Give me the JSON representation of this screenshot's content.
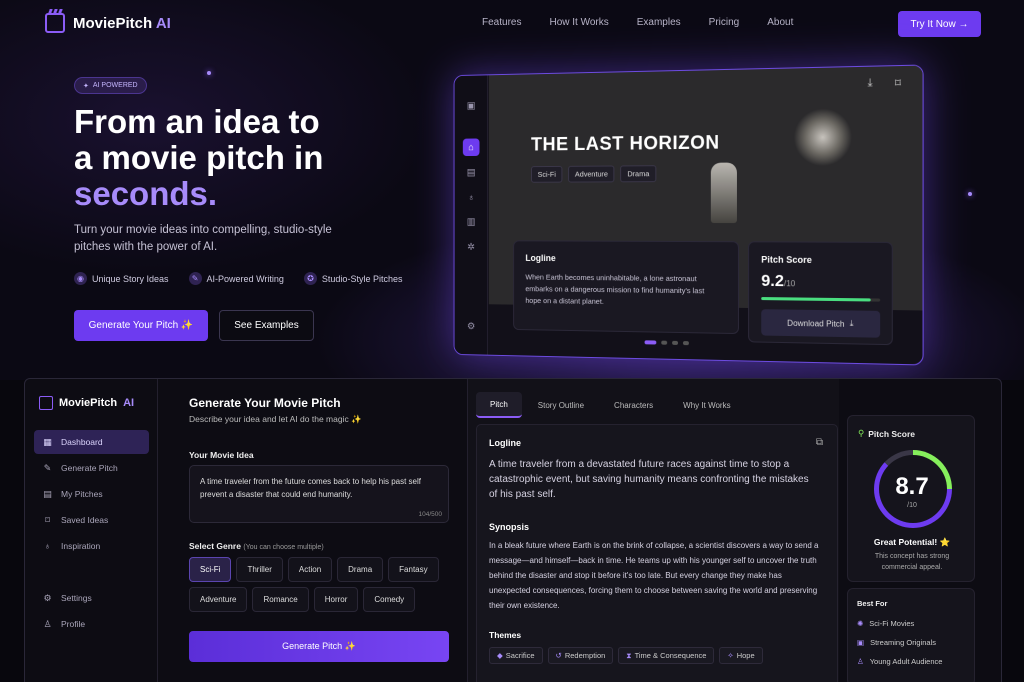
{
  "nav": {
    "brand": "MoviePitch",
    "brand_ai": "AI",
    "links": [
      "Features",
      "How It Works",
      "Examples",
      "Pricing",
      "About"
    ],
    "cta": "Try It Now →"
  },
  "hero": {
    "badge": "AI POWERED",
    "title_1": "From an idea to",
    "title_2": "a movie pitch in",
    "title_hl": "seconds.",
    "subtitle": "Turn your movie ideas into compelling, studio-style pitches with the power of AI.",
    "features": [
      "Unique Story Ideas",
      "AI-Powered Writing",
      "Studio-Style Pitches"
    ],
    "btn_generate": "Generate Your Pitch ✨",
    "btn_examples": "See Examples"
  },
  "mock": {
    "title": "THE LAST HORIZON",
    "tags": [
      "Sci-Fi",
      "Adventure",
      "Drama"
    ],
    "logline_h": "Logline",
    "logline": "When Earth becomes uninhabitable, a lone astronaut embarks on a dangerous mission to find humanity's last hope on a distant planet.",
    "score_h": "Pitch Score",
    "score": "9.2",
    "score_max": "/10",
    "score_fraction": 0.92,
    "download": "Download Pitch"
  },
  "app": {
    "brand": "MoviePitch",
    "brand_ai": "AI",
    "sidebar": [
      "Dashboard",
      "Generate Pitch",
      "My Pitches",
      "Saved Ideas",
      "Inspiration"
    ],
    "sidebar_bottom": [
      "Settings",
      "Profile"
    ],
    "gen": {
      "title": "Generate Your Movie Pitch",
      "subtitle": "Describe your idea and let AI do the magic ✨",
      "idea_label": "Your Movie Idea",
      "idea": "A time traveler from the future comes back to help his past self prevent a disaster that could end humanity.",
      "count": "104/500",
      "genre_label": "Select Genre",
      "genre_hint": "(You can choose multiple)",
      "genres": [
        "Sci-Fi",
        "Thriller",
        "Action",
        "Drama",
        "Fantasy",
        "Adventure",
        "Romance",
        "Horror",
        "Comedy"
      ],
      "button": "Generate Pitch ✨"
    },
    "tabs": [
      "Pitch",
      "Story Outline",
      "Characters",
      "Why It Works"
    ],
    "pitch": {
      "logline_h": "Logline",
      "logline": "A time traveler from a devastated future races against time to stop a catastrophic event, but saving humanity means confronting the mistakes of his past self.",
      "synopsis_h": "Synopsis",
      "synopsis": "In a bleak future where Earth is on the brink of collapse, a scientist discovers a way to send a message—and himself—back in time. He teams up with his younger self to uncover the truth behind the disaster and stop it before it's too late. But every change they make has unexpected consequences, forcing them to choose between saving the world and preserving their own existence.",
      "themes_h": "Themes",
      "themes": [
        "Sacrifice",
        "Redemption",
        "Time & Consequence",
        "Hope"
      ]
    },
    "score": {
      "title": "Pitch Score",
      "value": "8.7",
      "max": "/10",
      "verdict": "Great Potential! ⭐",
      "desc": "This concept has strong commercial appeal."
    },
    "best_for": {
      "title": "Best For",
      "items": [
        "Sci-Fi Movies",
        "Streaming Originals",
        "Young Adult Audience"
      ]
    }
  }
}
